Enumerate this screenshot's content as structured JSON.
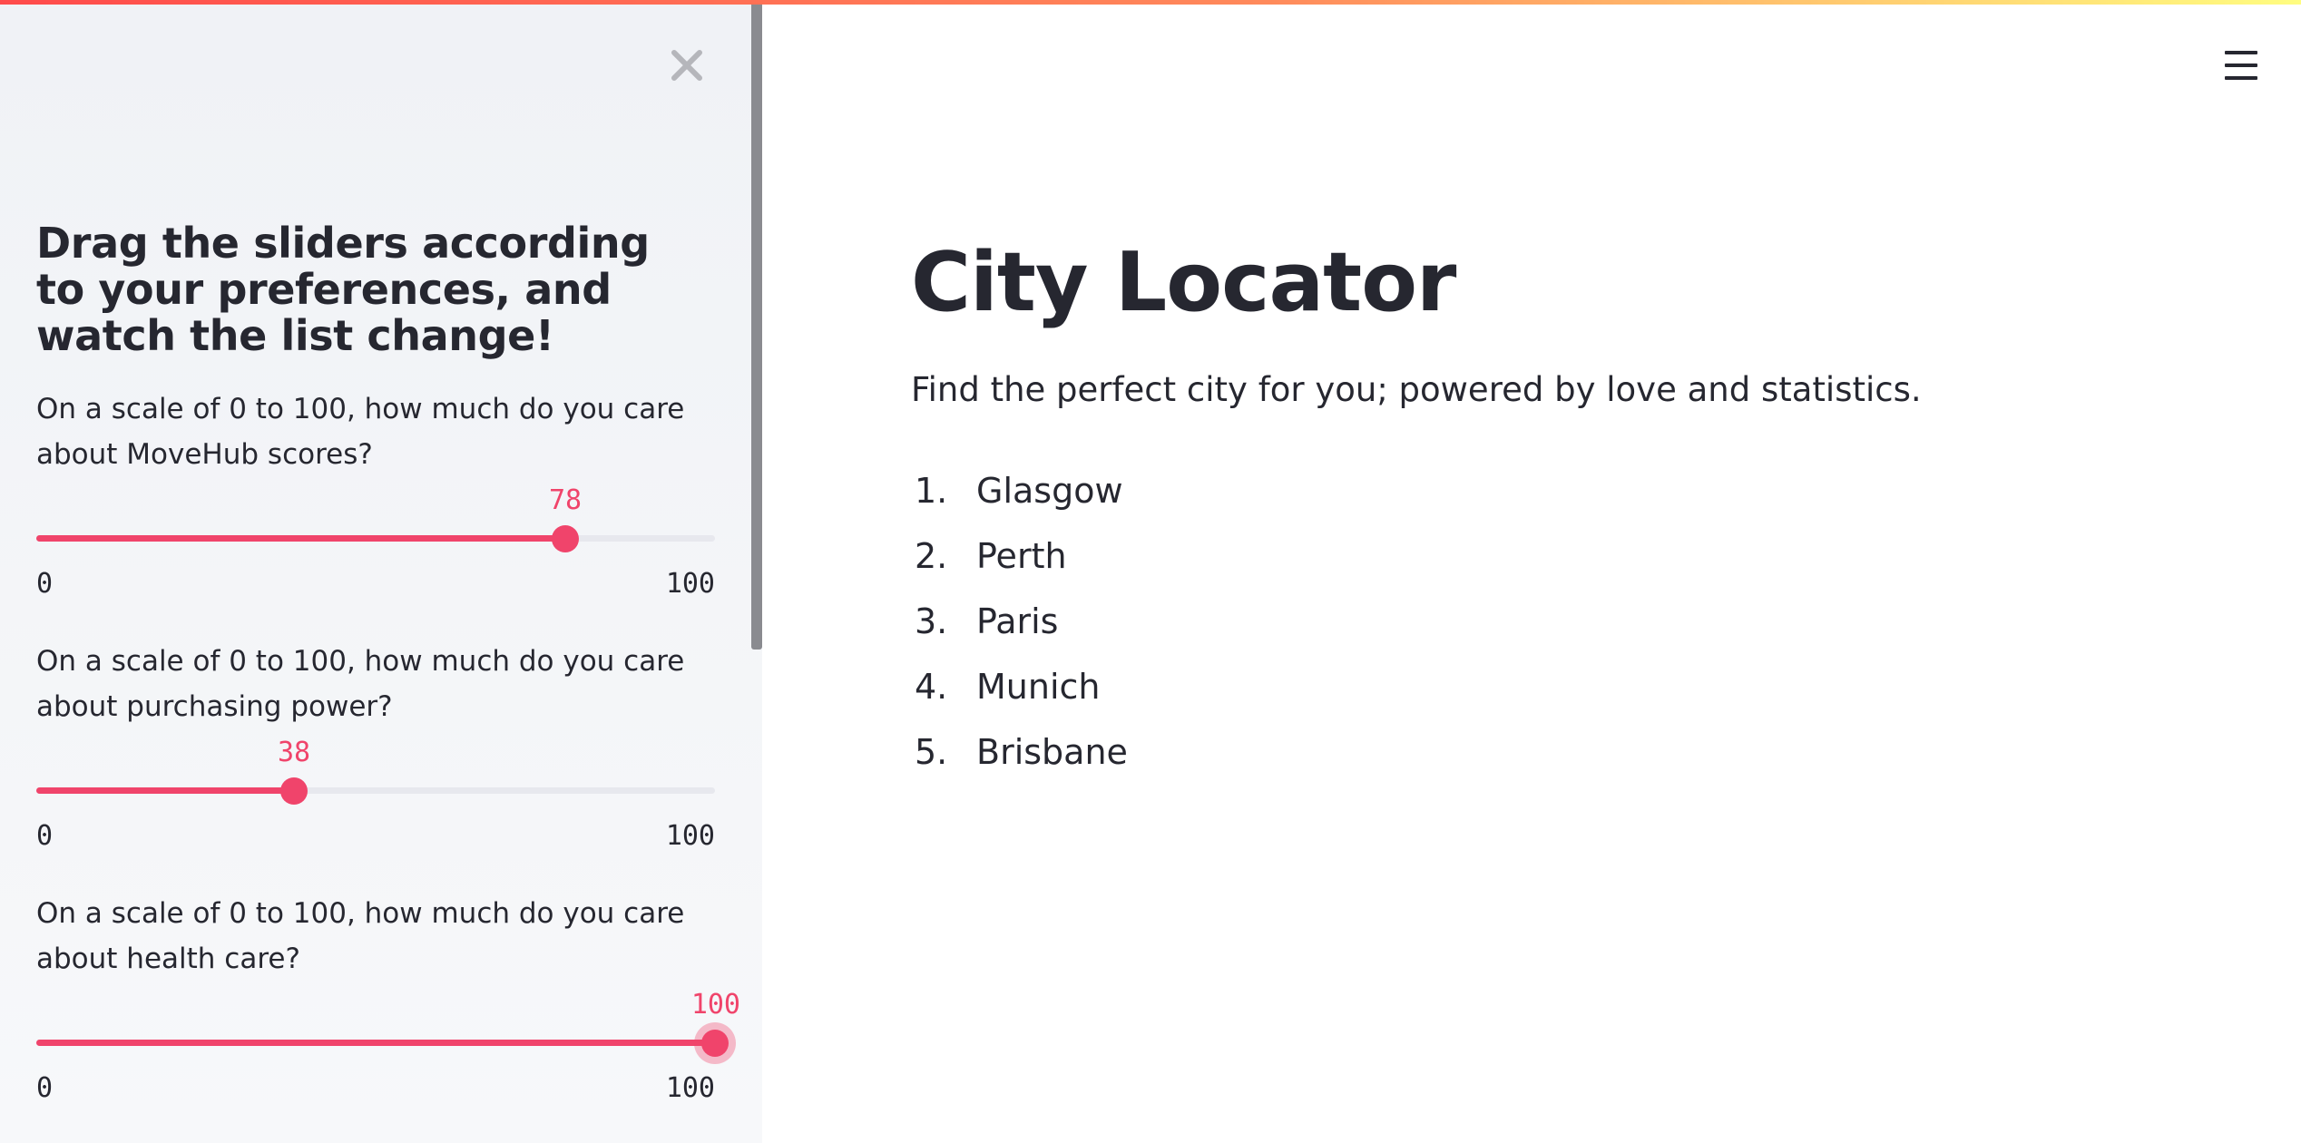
{
  "sidebar": {
    "title": "Drag the sliders according to your preferences, and watch the list change!",
    "sliders": [
      {
        "label": "On a scale of 0 to 100, how much do you care about MoveHub scores?",
        "value": "78",
        "min": "0",
        "max": "100"
      },
      {
        "label": "On a scale of 0 to 100, how much do you care about purchasing power?",
        "value": "38",
        "min": "0",
        "max": "100"
      },
      {
        "label": "On a scale of 0 to 100, how much do you care about health care?",
        "value": "100",
        "min": "0",
        "max": "100"
      }
    ]
  },
  "main": {
    "title": "City Locator",
    "subtitle": "Find the perfect city for you; powered by love and statistics.",
    "cities": [
      {
        "rank": "1.",
        "name": "Glasgow"
      },
      {
        "rank": "2.",
        "name": "Perth"
      },
      {
        "rank": "3.",
        "name": "Paris"
      },
      {
        "rank": "4.",
        "name": "Munich"
      },
      {
        "rank": "5.",
        "name": "Brisbane"
      }
    ]
  },
  "colors": {
    "accent": "#f0446b",
    "sidebar_bg": "#f0f2f6",
    "text": "#262730"
  },
  "icons": {
    "close": "close-icon",
    "menu": "hamburger-icon"
  }
}
